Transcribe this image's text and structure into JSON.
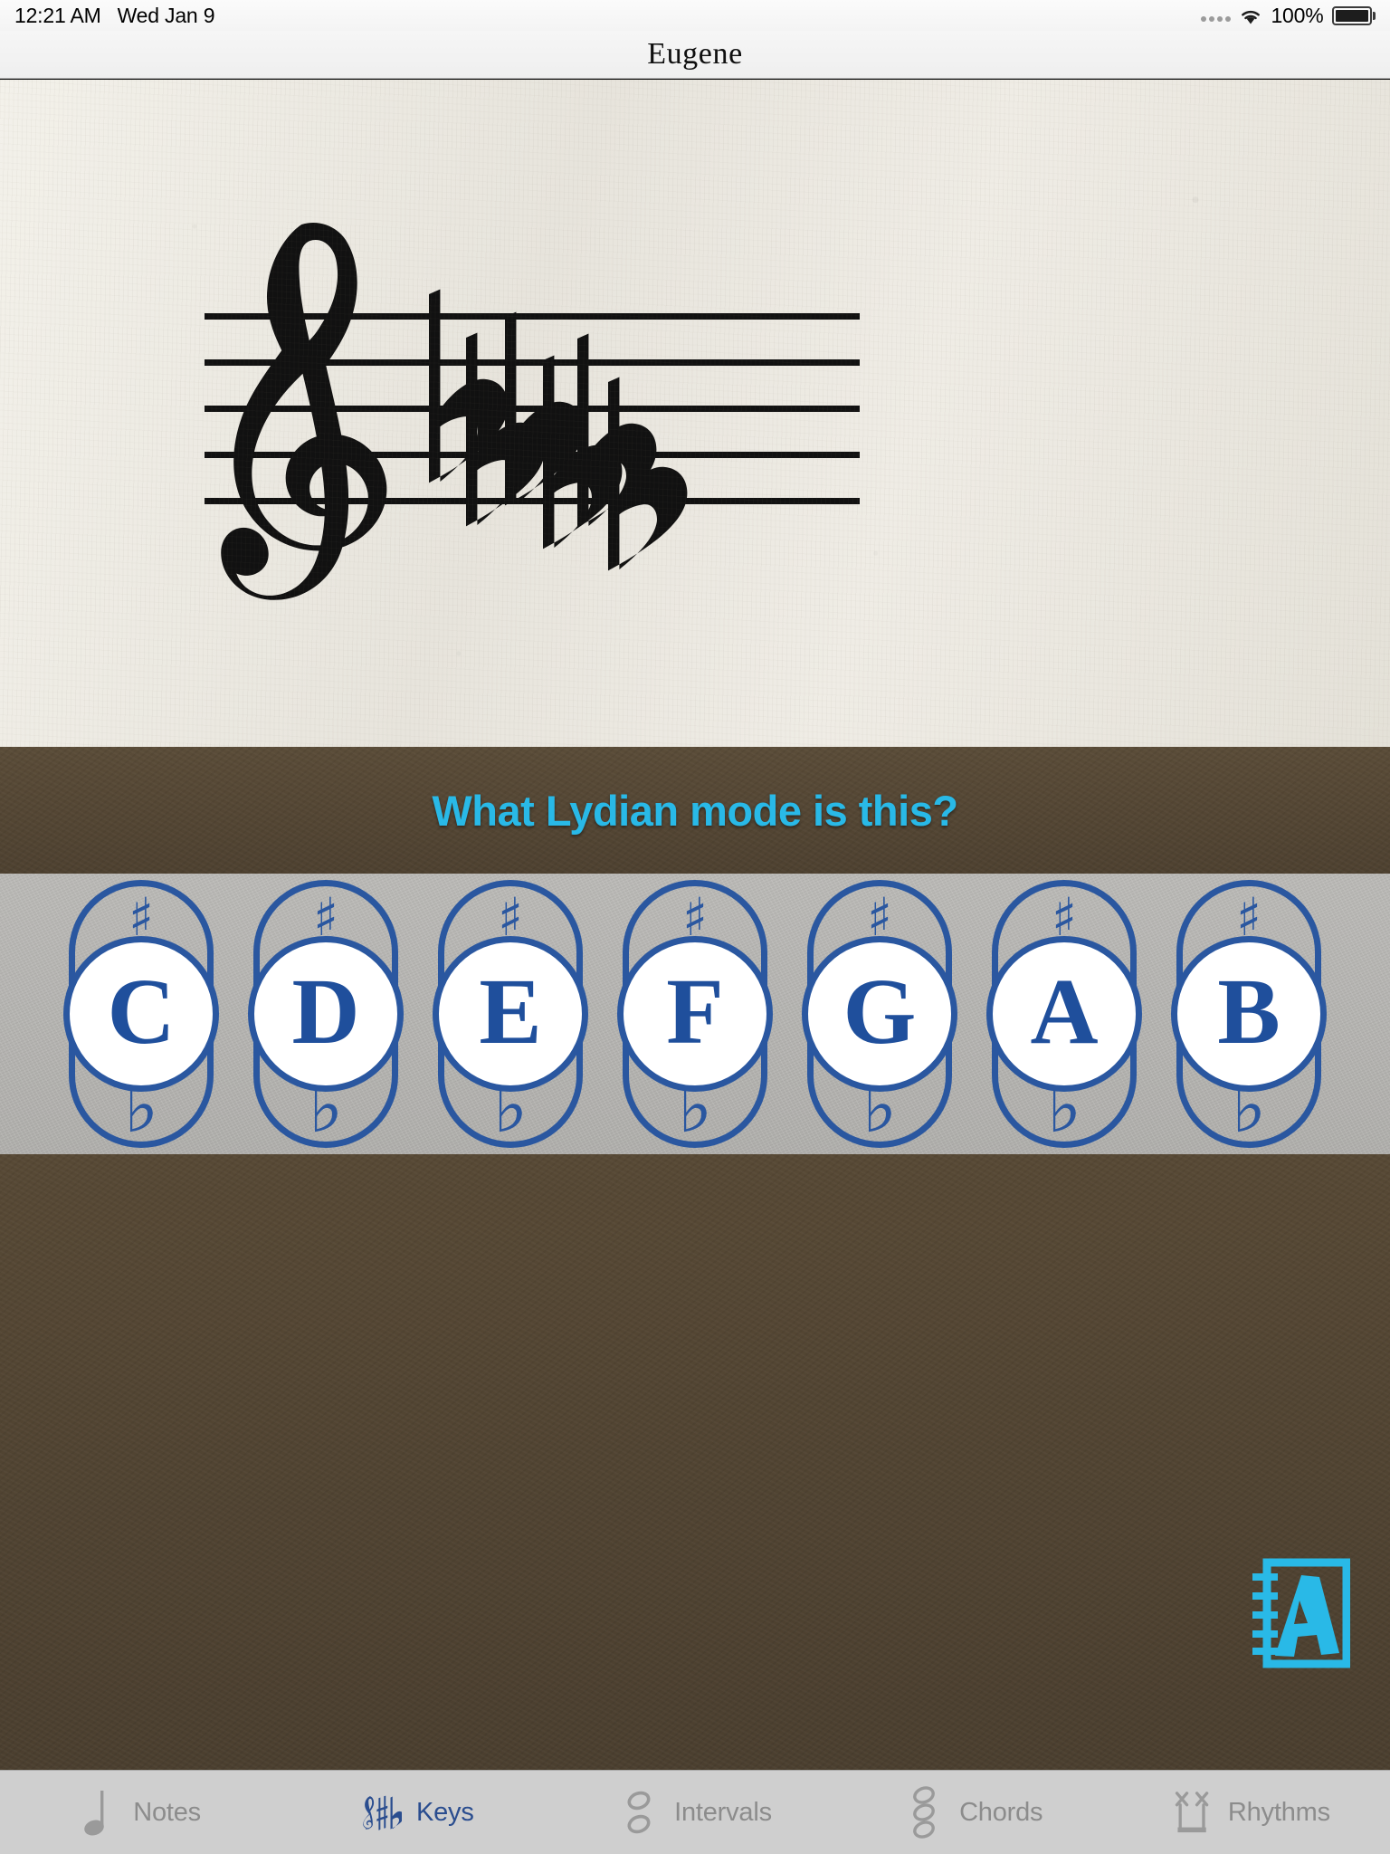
{
  "statusbar": {
    "time": "12:21 AM",
    "date": "Wed Jan 9",
    "battery_percent": "100%",
    "signal_icon": "signal-dots-icon",
    "wifi_icon": "wifi-icon",
    "battery_icon": "battery-full-icon"
  },
  "navbar": {
    "title": "Eugene"
  },
  "staff": {
    "clef": "treble-clef",
    "key_signature_accidental": "flat",
    "key_signature_count": 6,
    "flats_order": [
      "B",
      "E",
      "A",
      "D",
      "G",
      "C"
    ]
  },
  "question": {
    "text": "What Lydian mode is this?",
    "color": "#29b9e7"
  },
  "answers": {
    "sharp_glyph": "♯",
    "flat_glyph": "♭",
    "accent_color": "#2a57a0",
    "buttons": [
      {
        "letter": "C",
        "sharp": "♯",
        "flat": "♭"
      },
      {
        "letter": "D",
        "sharp": "♯",
        "flat": "♭"
      },
      {
        "letter": "E",
        "sharp": "♯",
        "flat": "♭"
      },
      {
        "letter": "F",
        "sharp": "♯",
        "flat": "♭"
      },
      {
        "letter": "G",
        "sharp": "♯",
        "flat": "♭"
      },
      {
        "letter": "A",
        "sharp": "♯",
        "flat": "♭"
      },
      {
        "letter": "B",
        "sharp": "♯",
        "flat": "♭"
      }
    ]
  },
  "reference": {
    "icon": "reference-book-a-icon",
    "letter": "A",
    "color": "#29b9e7"
  },
  "tabbar": {
    "selected": "Keys",
    "active_color": "#2a4d8f",
    "inactive_color": "#8c8c8c",
    "tabs": [
      {
        "label": "Notes",
        "icon": "quarter-note-icon"
      },
      {
        "label": "Keys",
        "icon": "clef-sharp-flat-icon"
      },
      {
        "label": "Intervals",
        "icon": "two-noteheads-icon"
      },
      {
        "label": "Chords",
        "icon": "three-noteheads-icon"
      },
      {
        "label": "Rhythms",
        "icon": "rhythm-x-notes-icon"
      }
    ]
  }
}
